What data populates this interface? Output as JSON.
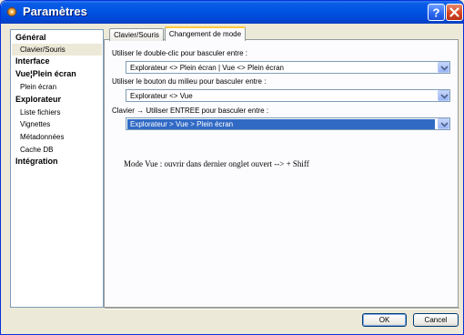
{
  "window": {
    "title": "Paramètres"
  },
  "sidebar": {
    "items": [
      {
        "label": "Général",
        "level": 0
      },
      {
        "label": "Clavier/Souris",
        "level": 1,
        "selected": true
      },
      {
        "label": "Interface",
        "level": 0
      },
      {
        "label": "Vue¦Plein écran",
        "level": 0
      },
      {
        "label": "Plein écran",
        "level": 1
      },
      {
        "label": "Explorateur",
        "level": 0
      },
      {
        "label": "Liste fichiers",
        "level": 1
      },
      {
        "label": "Vignettes",
        "level": 1
      },
      {
        "label": "Métadonnées",
        "level": 1
      },
      {
        "label": "Cache DB",
        "level": 1
      },
      {
        "label": "Intégration",
        "level": 0
      }
    ]
  },
  "tabs": [
    {
      "label": "Clavier/Souris",
      "active": false
    },
    {
      "label": "Changement de mode",
      "active": true
    }
  ],
  "settings": {
    "double_click": {
      "label": "Utiliser le double-clic pour basculer entre :",
      "value": "Explorateur <> Plein écran | Vue <> Plein écran"
    },
    "middle_button": {
      "label": "Utiliser le bouton du milieu pour basculer entre :",
      "value": "Explorateur <> Vue"
    },
    "enter_key": {
      "label": "Clavier → Utiliser ENTREE pour basculer entre :",
      "value": "Explorateur > Vue > Plein écran"
    }
  },
  "note": "Mode Vue : ouvrir dans dernier onglet ouvert --> + Shiff",
  "buttons": {
    "ok": "OK",
    "cancel": "Cancel"
  },
  "colors": {
    "title_bar": "#0054e3",
    "selection": "#316ac5",
    "tab_accent": "#ffc83c",
    "close_button": "#d6461f"
  },
  "icons": {
    "app": "gear-icon",
    "help": "help-icon",
    "close": "close-icon",
    "dropdown": "chevron-down-icon"
  }
}
